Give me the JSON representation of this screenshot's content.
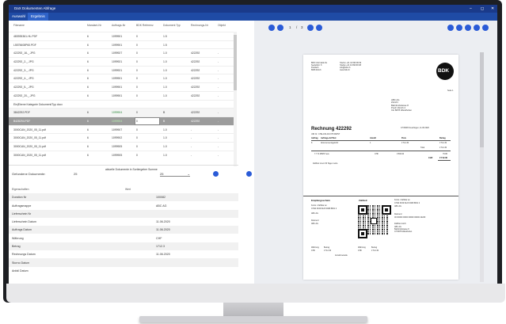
{
  "window": {
    "title": "DaX Dokumenten Abfrage",
    "controls": [
      "–",
      "◻",
      "✕"
    ]
  },
  "tabs": [
    {
      "label": "Auswahl"
    },
    {
      "label": "Ergebnis"
    }
  ],
  "table": {
    "headers": [
      "Filename",
      "Mandant-Nr",
      "Auftrags-Nr",
      "BDK Referenz",
      "Dokument Typ",
      "Rechnungs-Nr",
      "Objekt"
    ],
    "rows": [
      [
        "483935361-HL.PDF",
        "6",
        "1099901",
        "0",
        "1.5",
        "",
        ""
      ],
      [
        "L5575608P60.PDF",
        "6",
        "1099901",
        "0",
        "1.5",
        "",
        ""
      ],
      [
        "422292_16-_.JPG",
        "6",
        "1099927",
        "0",
        "1.0",
        "422292",
        "-"
      ],
      [
        "422292_2-_.JPG",
        "6",
        "1099921",
        "0",
        "1.0",
        "422292",
        "-"
      ],
      [
        "422292_3-_.JPG",
        "6",
        "1099921",
        "0",
        "1.0",
        "422292",
        "-"
      ],
      [
        "422292_4-_.JPG",
        "6",
        "1099901",
        "0",
        "1.0",
        "422292",
        "-"
      ],
      [
        "422292_5-_.JPG",
        "6",
        "1099901",
        "0",
        "1.0",
        "422292",
        "-"
      ],
      [
        "422292_20-_.JPG",
        "6",
        "1099901",
        "0",
        "1.0",
        "422292",
        "-"
      ],
      [
        "Ein|Ebene Kategorie Dokument/Typ docx",
        "",
        "",
        "",
        "",
        "",
        ""
      ],
      [
        "3842292.PDF",
        "6",
        "1099904",
        "0",
        "B",
        "422292",
        "-"
      ],
      [
        "B428294.PDF",
        "6",
        "1099904",
        "0",
        "B",
        "422292",
        "-"
      ],
      [
        "3000CAN_2020_05_11.pdf",
        "6",
        "1099907",
        "0",
        "1.0",
        "-",
        "-"
      ],
      [
        "3000CAN_2020_05_11.pdf",
        "6",
        "1099902",
        "0",
        "1.0",
        "-",
        "-"
      ],
      [
        "3000CAN_2020_05_11.pdf",
        "6",
        "1099905",
        "0",
        "1.0",
        "-",
        "-"
      ],
      [
        "3000CAN_2020_05_11.pdf",
        "6",
        "1099905",
        "0",
        "1.0",
        "-",
        "-"
      ]
    ]
  },
  "summary": {
    "label": "Gefundene Dokumente:",
    "count": "25",
    "sum_label": "aktuelle Dokumente in Sortiergeber Summe",
    "sum_value": "25"
  },
  "properties": {
    "headers": [
      "Eigenschaften",
      "Wert"
    ],
    "rows": [
      [
        "Duration Nr",
        "100082"
      ],
      [
        "Auftragsmappe",
        "ABC AG"
      ],
      [
        "Lieferschein Nr",
        ""
      ],
      [
        "Lieferschein Datum",
        "11.06.2020"
      ],
      [
        "Auftrags Datum",
        "11.06.2020"
      ],
      [
        "Währung",
        "CHF"
      ],
      [
        "Betrag",
        "1712.3"
      ],
      [
        "Rechnungs Datum",
        "11.06.2020"
      ],
      [
        "Storno Datum",
        ""
      ],
      [
        "Anfall Datum",
        ""
      ]
    ]
  },
  "viewer": {
    "page": "1",
    "page_sep": "/",
    "total": "3"
  },
  "invoice": {
    "company_lines": [
      "BDK Informatik AG",
      "Seefeldstr. 8",
      "Postfach",
      "8008 Zürich"
    ],
    "contact_lines": [
      "Telefon +41 44 999 99 99",
      "Telefax +41 44 999 99 98",
      "info@bdk.ch",
      "www.bdk.ch"
    ],
    "logo_text": "BDK",
    "recipient": [
      "ABC AG",
      "Zürich I",
      "Bahnhofstrasse 8",
      "Postf. Zürich 2",
      "CH 8078 Wandhofen"
    ],
    "page_no": "Seite 1",
    "title": "Rechnung 422292",
    "mwst": "UID Nr.: CHE-109.416.678 MWST",
    "date": "CH 8008 Kreuzlingen, 11.06.2020",
    "columns": [
      "Auftrag",
      "Auftrags-Art/Text",
      "Anzahl",
      "Preis",
      "Betrag"
    ],
    "line1": [
      "8",
      "Abonnementsgebühr",
      "1",
      "1'712.30",
      "1'712.30"
    ],
    "total_label": "Total",
    "total_value": "1'712.30",
    "tax_text": "7.7 % MWST aus",
    "currency": "CHF",
    "tax_base": "1'500.00",
    "tax_value": "76.80",
    "grand_value": "1'712.30",
    "payment_terms": "Zahlbar innert 30 Tagen netto.",
    "payee_title": "Zahlteil",
    "receipt_title": "Empfangsschein",
    "account_label": "Konto / Zahlbar an",
    "iban": "CH44 3199 9123 0008 8901 2",
    "ref_label": "Referenz",
    "ref_value": "00 00000 00000 00000 00000 42229",
    "amount_label": "Betrag",
    "amount_value": "1'712.30",
    "currency_label": "Währung",
    "payer_label": "Zahlbar durch",
    "payer_name": "ABC AG",
    "accept_label": "Annahmestelle"
  }
}
